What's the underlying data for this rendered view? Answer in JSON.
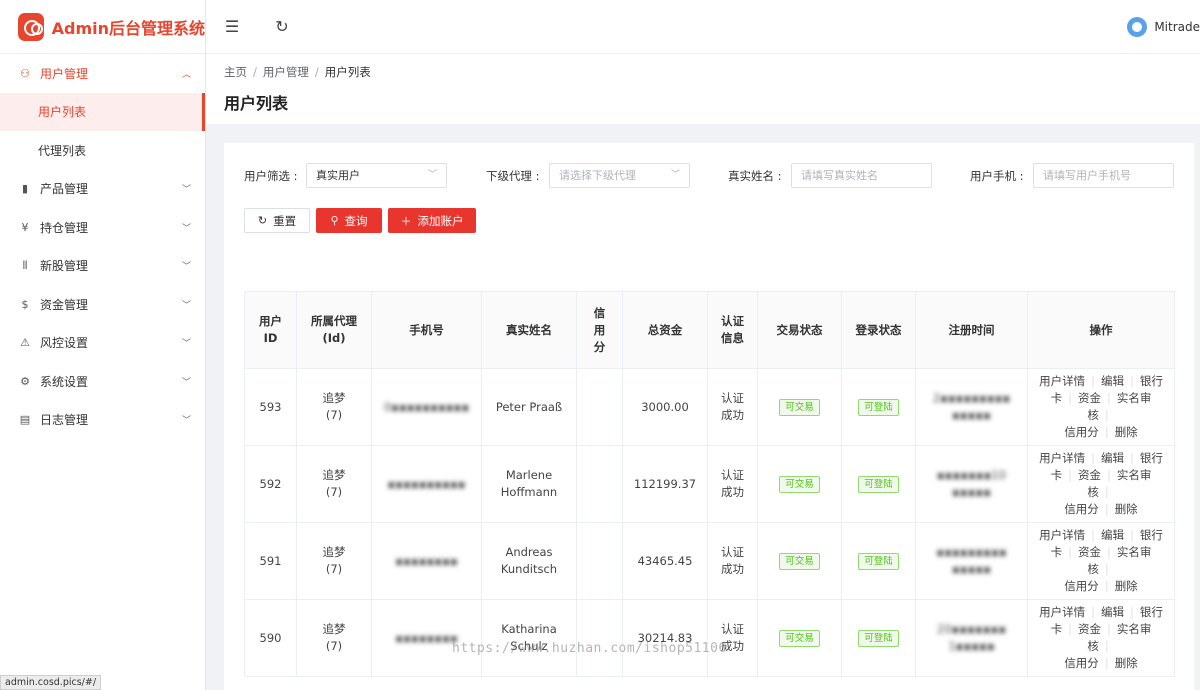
{
  "app": {
    "title": "Admin后台管理系统"
  },
  "header": {
    "username": "Mitrade"
  },
  "sidebar": {
    "items": [
      {
        "label": "用户管理",
        "icon": "user-group-icon",
        "open": true,
        "children": [
          {
            "label": "用户列表",
            "active": true
          },
          {
            "label": "代理列表",
            "active": false
          }
        ]
      },
      {
        "label": "产品管理",
        "icon": "chart-bar-icon"
      },
      {
        "label": "持仓管理",
        "icon": "ledger-icon"
      },
      {
        "label": "新股管理",
        "icon": "ipo-icon"
      },
      {
        "label": "资金管理",
        "icon": "dollar-icon"
      },
      {
        "label": "风控设置",
        "icon": "warning-icon"
      },
      {
        "label": "系统设置",
        "icon": "gear-icon"
      },
      {
        "label": "日志管理",
        "icon": "log-icon"
      }
    ]
  },
  "breadcrumb": [
    "主页",
    "用户管理",
    "用户列表"
  ],
  "page": {
    "title": "用户列表"
  },
  "filters": {
    "user_filter_label": "用户筛选 :",
    "user_filter_value": "真实用户",
    "agent_label": "下级代理 :",
    "agent_placeholder": "请选择下级代理",
    "name_label": "真实姓名 :",
    "name_placeholder": "请填写真实姓名",
    "phone_label": "用户手机 :",
    "phone_placeholder": "请填写用户手机号"
  },
  "buttons": {
    "reset": "重置",
    "search": "查询",
    "add": "添加账户"
  },
  "table": {
    "headers": [
      "用户\nID",
      "所属代理\n(Id)",
      "手机号",
      "真实姓名",
      "信\n用\n分",
      "总资金",
      "认证\n信息",
      "交易状态",
      "登录状态",
      "注册时间",
      "操作"
    ],
    "rows": [
      {
        "id": "593",
        "agent": "追梦",
        "agent_id": "(7)",
        "phone": "0▪▪▪▪▪▪▪▪▪▪",
        "name": "Peter Praaß",
        "credit": "",
        "funds": "3000.00",
        "auth": "认证\n成功",
        "trade": "可交易",
        "login": "可登陆",
        "reg1": "2▪▪▪▪▪▪▪▪▪",
        "reg2": "▪▪▪▪▪"
      },
      {
        "id": "592",
        "agent": "追梦",
        "agent_id": "(7)",
        "phone": "▪▪▪▪▪▪▪▪▪▪",
        "name": "Marlene\nHoffmann",
        "credit": "",
        "funds": "112199.37",
        "auth": "认证\n成功",
        "trade": "可交易",
        "login": "可登陆",
        "reg1": "▪▪▪▪▪▪▪10",
        "reg2": "▪▪▪▪▪"
      },
      {
        "id": "591",
        "agent": "追梦",
        "agent_id": "(7)",
        "phone": "▪▪▪▪▪▪▪▪",
        "name": "Andreas\nKunditsch",
        "credit": "",
        "funds": "43465.45",
        "auth": "认证\n成功",
        "trade": "可交易",
        "login": "可登陆",
        "reg1": "▪▪▪▪▪▪▪▪▪",
        "reg2": "▪▪▪▪▪"
      },
      {
        "id": "590",
        "agent": "追梦",
        "agent_id": "(7)",
        "phone": "▪▪▪▪▪▪▪▪",
        "name": "Katharina\nSchulz",
        "credit": "",
        "funds": "30214.83",
        "auth": "认证\n成功",
        "trade": "可交易",
        "login": "可登陆",
        "reg1": "20▪▪▪▪▪▪▪",
        "reg2": "1▪▪▪▪▪"
      }
    ],
    "ops": {
      "detail": "用户详情",
      "edit": "编辑",
      "bank": "银行",
      "card": "卡",
      "funds": "资金",
      "kyc": "实名审核",
      "credit": "信用分",
      "delete": "删除"
    }
  },
  "statusbar": {
    "url": "admin.cosd.pics/#/"
  },
  "watermark": {
    "text": "https://www.huzhan.com/ishop51106"
  }
}
